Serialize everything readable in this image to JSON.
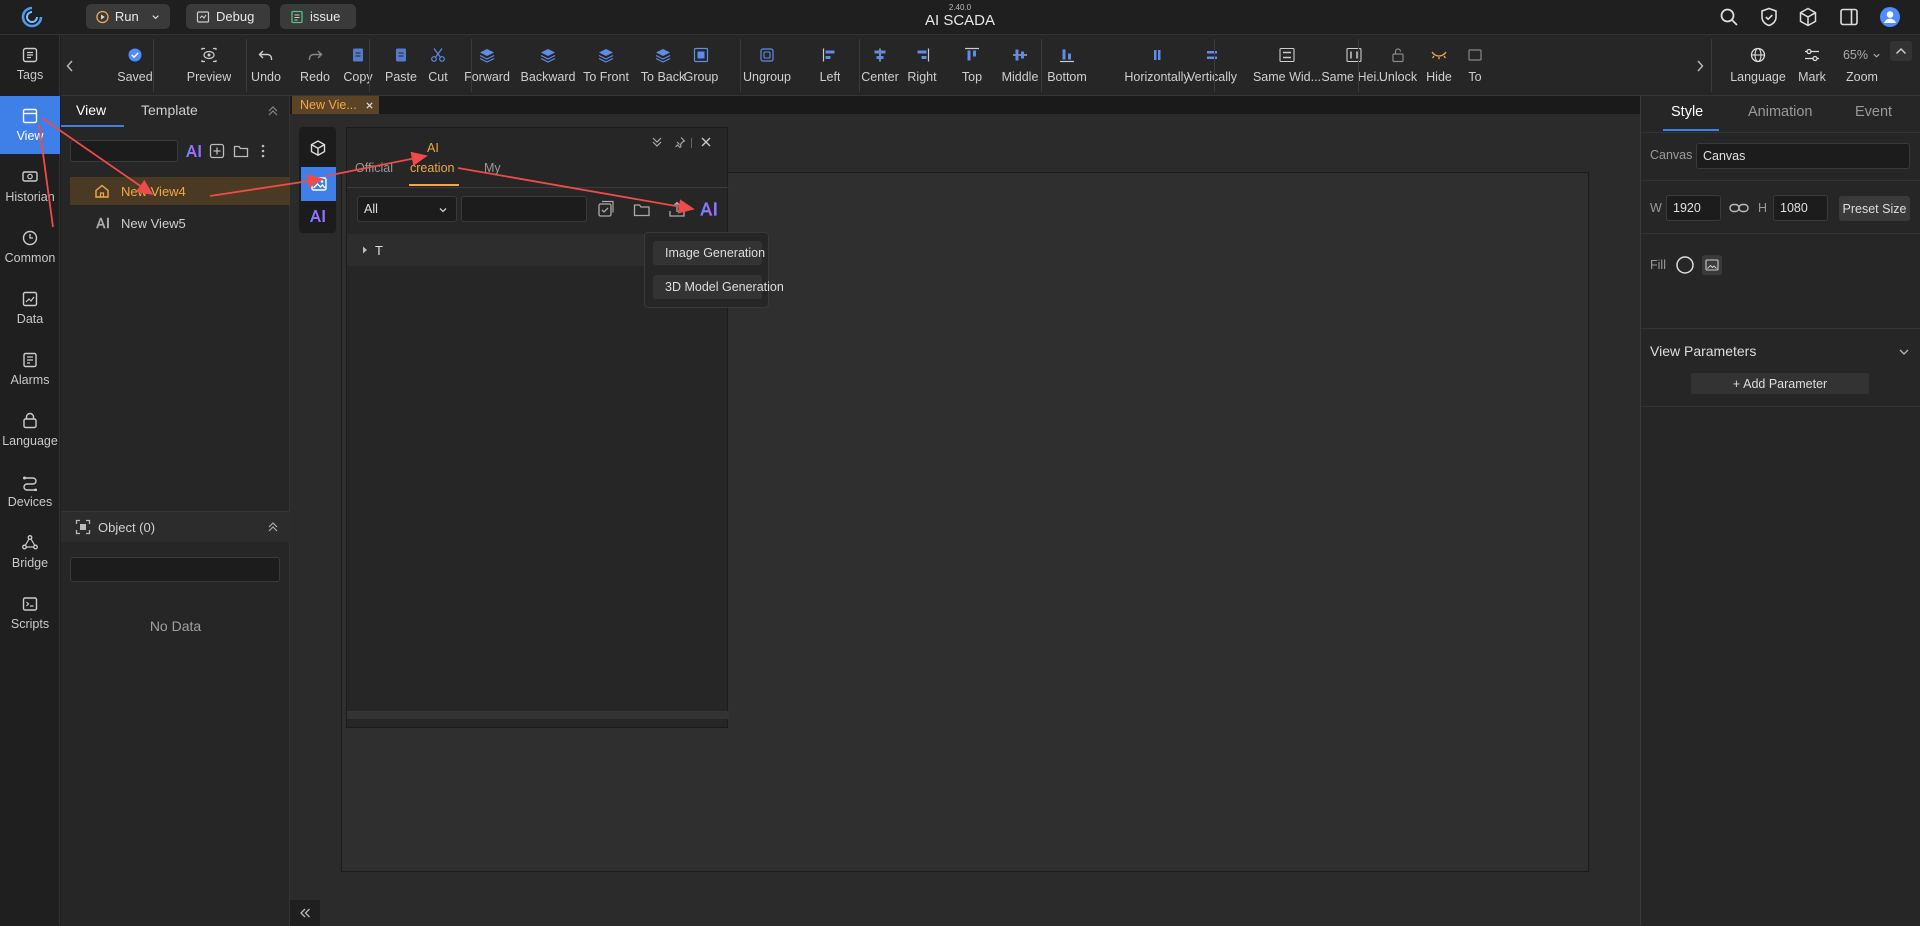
{
  "app": {
    "version": "2.40.0",
    "title": "AI SCADA"
  },
  "titlebar": {
    "run_label": "Run",
    "debug_label": "Debug",
    "issue_label": "issue"
  },
  "leftnav": {
    "items": [
      {
        "label": "Tags",
        "icon": "tags-icon"
      },
      {
        "label": "View",
        "icon": "view-icon",
        "active": true
      },
      {
        "label": "Historian",
        "icon": "historian-icon"
      },
      {
        "label": "Common",
        "icon": "common-icon"
      },
      {
        "label": "Data",
        "icon": "data-icon"
      },
      {
        "label": "Alarms",
        "icon": "alarms-icon"
      },
      {
        "label": "Language",
        "icon": "language-icon"
      },
      {
        "label": "Devices",
        "icon": "devices-icon"
      },
      {
        "label": "Bridge",
        "icon": "bridge-icon"
      },
      {
        "label": "Scripts",
        "icon": "scripts-icon"
      }
    ]
  },
  "toolbar": {
    "tools": [
      "Saved",
      "Preview",
      "Undo",
      "Redo",
      "Copy",
      "Paste",
      "Cut",
      "Forward",
      "Backward",
      "To Front",
      "To Back",
      "Group",
      "Ungroup",
      "Left",
      "Center",
      "Right",
      "Top",
      "Middle",
      "Bottom",
      "Horizontally",
      "Vertically",
      "Same Wid...",
      "Same Hei...",
      "Unlock",
      "Hide",
      "To"
    ],
    "right_tools": [
      "Language",
      "Mark",
      "Zoom"
    ],
    "zoom_value": "65%"
  },
  "viewpanel": {
    "tabs": [
      "View",
      "Template"
    ],
    "active_tab": "View",
    "search_value": "",
    "views": [
      {
        "name": "New View4",
        "selected": true
      },
      {
        "name": "New View5",
        "selected": false
      }
    ],
    "object_header": "Object (0)",
    "object_search_value": "",
    "empty_text": "No Data"
  },
  "editor_tab": {
    "label": "New Vie..."
  },
  "component_panel": {
    "tabs": [
      "Official",
      "AI",
      "creation",
      "My"
    ],
    "active_tab": "AI creation",
    "filter_value": "All",
    "search_value": "",
    "tree_item": "T",
    "menu": [
      "Image Generation",
      "3D Model Generation"
    ]
  },
  "rightpanel": {
    "tabs": [
      "Style",
      "Animation",
      "Event"
    ],
    "active_tab": "Style",
    "canvas_label": "Canvas",
    "canvas_value": "Canvas",
    "w_label": "W",
    "w_value": "1920",
    "h_label": "H",
    "h_value": "1080",
    "preset_label": "Preset Size",
    "fill_label": "Fill",
    "params_title": "View Parameters",
    "add_param_label": "Add Parameter",
    "add_param_plus": "+"
  },
  "colors": {
    "accent": "#3f7fe8",
    "orange": "#f0a84a",
    "annotation": "#ee4b4b"
  }
}
